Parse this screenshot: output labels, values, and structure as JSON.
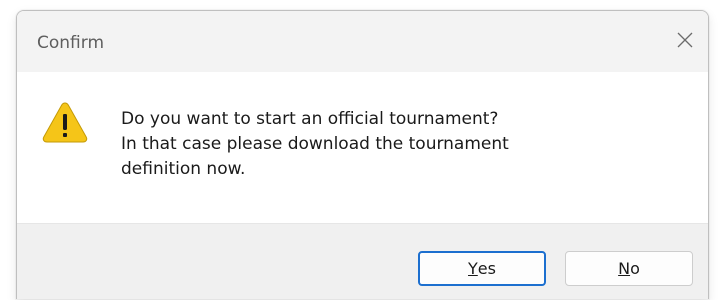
{
  "window": {
    "title": "Confirm",
    "close_icon": "close-icon"
  },
  "message": {
    "icon": "warning-icon",
    "lines": [
      "Do you want to start an official tournament?",
      "In that case please download the tournament",
      "definition now."
    ]
  },
  "buttons": {
    "yes": {
      "accel": "Y",
      "rest": "es"
    },
    "no": {
      "accel": "N",
      "rest": "o"
    }
  },
  "colors": {
    "warning_fill": "#f5c518",
    "default_button_border": "#1c6fcf",
    "footer_background": "#f0f0f0"
  }
}
